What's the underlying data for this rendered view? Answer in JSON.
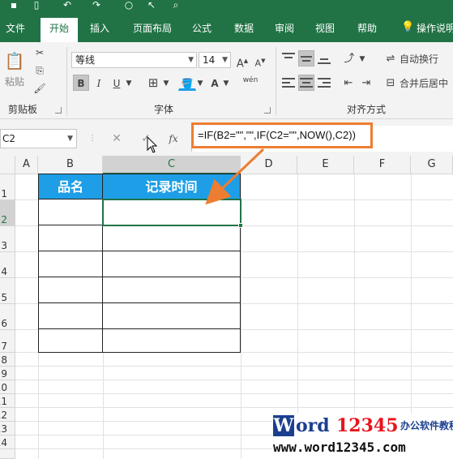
{
  "ribbon_tabs": [
    "文件",
    "开始",
    "插入",
    "页面布局",
    "公式",
    "数据",
    "审阅",
    "视图",
    "帮助"
  ],
  "tell_me": "操作说明",
  "clipboard": {
    "paste_label": "粘贴",
    "group_label": "剪贴板"
  },
  "font": {
    "name": "等线",
    "size": "14",
    "group_label": "字体",
    "bold": "B",
    "italic": "I",
    "underline": "U",
    "font_color": "A",
    "grow": "A",
    "shrink": "A",
    "phonetic": "wén"
  },
  "alignment": {
    "wrap_label": "自动换行",
    "merge_label": "合并后居中",
    "group_label": "对齐方式"
  },
  "formula_bar": {
    "name_box": "C2",
    "fx": "fx",
    "cancel": "✕",
    "enter": "✓",
    "formula": "=IF(B2=\"\",\"\",IF(C2=\"\",NOW(),C2))"
  },
  "columns": [
    "A",
    "B",
    "C",
    "D",
    "E",
    "F",
    "G"
  ],
  "rows": [
    "1",
    "2",
    "3",
    "4",
    "5",
    "6",
    "7",
    "8",
    "9",
    "10",
    "11",
    "12",
    "13",
    "14"
  ],
  "table": {
    "header": [
      "品名",
      "记录时间"
    ]
  },
  "annotation_color": "#ed7d31",
  "accent_color": "#217346",
  "header_fill_color": "#1e9ee6",
  "watermark": {
    "w": "W",
    "ord": "ord",
    "num": "12345",
    "cn": "办公软件教程",
    "url": "www.word12345.com"
  }
}
